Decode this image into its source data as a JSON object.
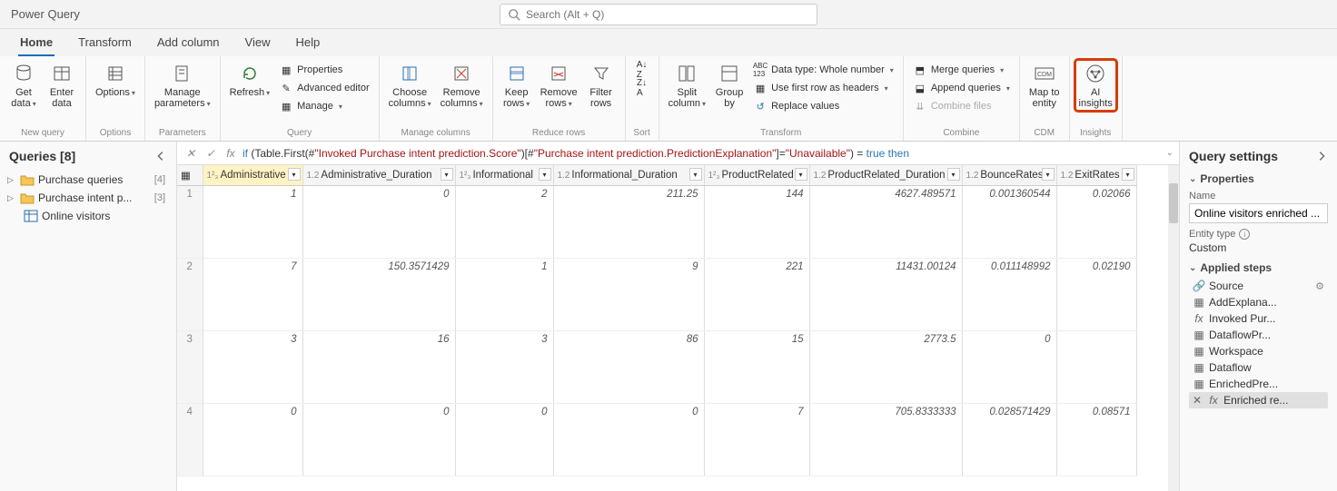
{
  "app_title": "Power Query",
  "search_placeholder": "Search (Alt + Q)",
  "tabs": [
    "Home",
    "Transform",
    "Add column",
    "View",
    "Help"
  ],
  "active_tab": 0,
  "ribbon": {
    "groups": [
      {
        "label": "New query",
        "items": [
          {
            "label": "Get\ndata"
          },
          {
            "label": "Enter\ndata"
          }
        ]
      },
      {
        "label": "Options",
        "items": [
          {
            "label": "Options"
          }
        ]
      },
      {
        "label": "Parameters",
        "items": [
          {
            "label": "Manage\nparameters"
          }
        ]
      },
      {
        "label": "Query",
        "refresh": "Refresh",
        "props": [
          "Properties",
          "Advanced editor",
          "Manage"
        ]
      },
      {
        "label": "Manage columns",
        "items": [
          {
            "label": "Choose\ncolumns"
          },
          {
            "label": "Remove\ncolumns"
          }
        ]
      },
      {
        "label": "Reduce rows",
        "items": [
          {
            "label": "Keep\nrows"
          },
          {
            "label": "Remove\nrows"
          },
          {
            "label": "Filter\nrows"
          }
        ]
      },
      {
        "label": "Sort"
      },
      {
        "label": "Transform",
        "items": [
          {
            "label": "Split\ncolumn"
          },
          {
            "label": "Group\nby"
          }
        ],
        "extras": [
          "Data type: Whole number",
          "Use first row as headers",
          "Replace values"
        ]
      },
      {
        "label": "Combine",
        "extras": [
          "Merge queries",
          "Append queries",
          "Combine files"
        ]
      },
      {
        "label": "CDM",
        "items": [
          {
            "label": "Map to\nentity"
          }
        ]
      },
      {
        "label": "Insights",
        "items": [
          {
            "label": "AI\ninsights"
          }
        ]
      }
    ]
  },
  "queries": {
    "title": "Queries [8]",
    "nodes": [
      {
        "label": "Purchase queries",
        "count": "[4]",
        "type": "folder"
      },
      {
        "label": "Purchase intent p...",
        "count": "[3]",
        "type": "folder"
      },
      {
        "label": "Online visitors",
        "type": "table"
      }
    ]
  },
  "fx": {
    "prefix": "if",
    "body1": " (Table.First(#",
    "str1": "\"Invoked Purchase intent prediction.Score\"",
    "body2": ")[#",
    "str2": "\"Purchase intent prediction.PredictionExplanation\"",
    "body3": "]=",
    "str3": "\"Unavailable\"",
    "body4": ") = ",
    "kw2": "true then"
  },
  "grid": {
    "columns": [
      "Administrative",
      "Administrative_Duration",
      "Informational",
      "Informational_Duration",
      "ProductRelated",
      "ProductRelated_Duration",
      "BounceRates",
      "ExitRates"
    ],
    "types": [
      "1²₃",
      "1.2",
      "1²₃",
      "1.2",
      "1²₃",
      "1.2",
      "1.2",
      "1.2"
    ],
    "rows": [
      {
        "n": "1",
        "c": [
          "1",
          "0",
          "2",
          "211.25",
          "144",
          "4627.489571",
          "0.001360544",
          "0.02066"
        ]
      },
      {
        "n": "2",
        "c": [
          "7",
          "150.3571429",
          "1",
          "9",
          "221",
          "11431.00124",
          "0.011148992",
          "0.02190"
        ]
      },
      {
        "n": "3",
        "c": [
          "3",
          "16",
          "3",
          "86",
          "15",
          "2773.5",
          "0",
          ""
        ]
      },
      {
        "n": "4",
        "c": [
          "0",
          "0",
          "0",
          "0",
          "7",
          "705.8333333",
          "0.028571429",
          "0.08571"
        ]
      }
    ]
  },
  "settings": {
    "title": "Query settings",
    "properties_label": "Properties",
    "name_label": "Name",
    "name_value": "Online visitors enriched ...",
    "entity_label": "Entity type",
    "entity_value": "Custom",
    "steps_label": "Applied steps",
    "steps": [
      {
        "icon": "link",
        "label": "Source",
        "gear": true
      },
      {
        "icon": "table",
        "label": "AddExplana..."
      },
      {
        "icon": "fx",
        "label": "Invoked Pur..."
      },
      {
        "icon": "table",
        "label": "DataflowPr..."
      },
      {
        "icon": "table",
        "label": "Workspace"
      },
      {
        "icon": "table",
        "label": "Dataflow"
      },
      {
        "icon": "table",
        "label": "EnrichedPre..."
      },
      {
        "icon": "fx",
        "label": "Enriched re...",
        "sel": true,
        "close": true
      }
    ]
  }
}
